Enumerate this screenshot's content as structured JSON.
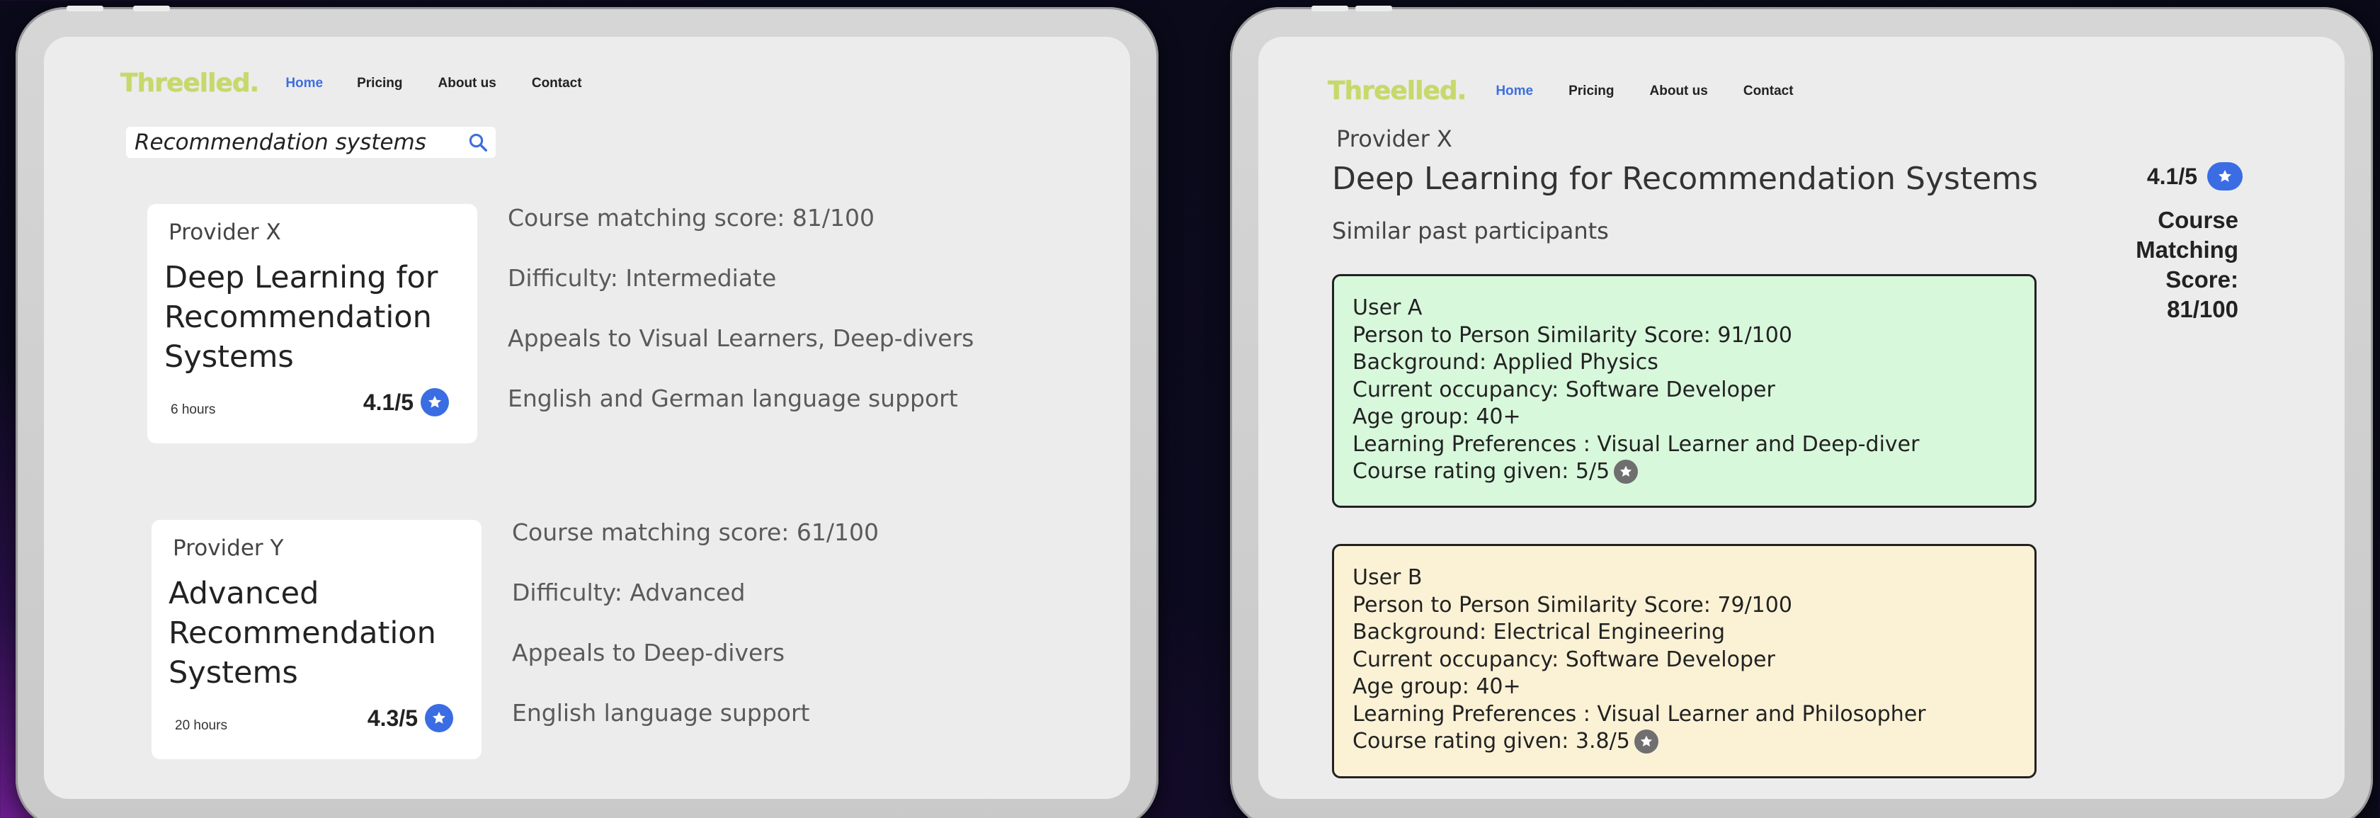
{
  "left": {
    "nav": {
      "logo": "Threelled.",
      "links": [
        "Home",
        "Pricing",
        "About us",
        "Contact"
      ]
    },
    "search": {
      "value": "Recommendation systems"
    },
    "courses": [
      {
        "provider": "Provider X",
        "title": "Deep Learning for Recommendation Systems",
        "hours": "6 hours",
        "rating": "4.1/5",
        "features": [
          "Course matching score: 81/100",
          "Difficulty: Intermediate",
          "Appeals to Visual Learners, Deep-divers",
          "English and German language support"
        ]
      },
      {
        "provider": "Provider Y",
        "title": "Advanced Recommendation Systems",
        "hours": "20 hours",
        "rating": "4.3/5",
        "features": [
          "Course matching score: 61/100",
          "Difficulty: Advanced",
          "Appeals to Deep-divers",
          "English language support"
        ]
      }
    ]
  },
  "right": {
    "nav": {
      "logo": "Threelled.",
      "links": [
        "Home",
        "Pricing",
        "About us",
        "Contact"
      ]
    },
    "provider": "Provider X",
    "title": "Deep Learning for Recommendation Systems",
    "subtitle": "Similar past participants",
    "rating": "4.1/5",
    "match_score": "Course Matching Score: 81/100",
    "users": [
      {
        "name": "User A",
        "similarity": "Person to Person Similarity Score: 91/100",
        "background": "Background: Applied Physics",
        "occupancy": "Current occupancy: Software Developer",
        "age": "Age group: 40+",
        "preferences": "Learning Preferences : Visual Learner and Deep-diver",
        "rating_given": "Course rating given: 5/5"
      },
      {
        "name": "User B",
        "similarity": "Person to Person Similarity Score: 79/100",
        "background": "Background: Electrical Engineering",
        "occupancy": "Current occupancy: Software Developer",
        "age": "Age group: 40+",
        "preferences": "Learning Preferences : Visual Learner and Philosopher",
        "rating_given": "Course rating given: 3.8/5"
      }
    ]
  },
  "colors": {
    "accent_blue": "#3d6fe0",
    "logo_green": "#c6d96a",
    "user_a_bg": "#d8f8dc",
    "user_b_bg": "#fbf2d6"
  }
}
